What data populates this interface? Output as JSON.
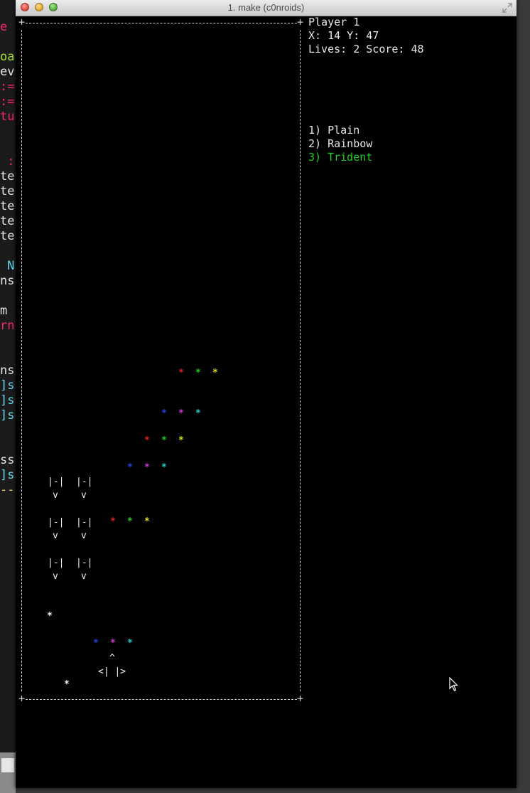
{
  "window": {
    "title": "1. make (c0nroids)"
  },
  "background_editor_fragments": [
    {
      "text": "e",
      "color": "#f92672"
    },
    {
      "text": "oa",
      "color": "#a6e22e"
    },
    {
      "text": "ev",
      "color": "#e6e6e6"
    },
    {
      "text": ":=",
      "color": "#f92672"
    },
    {
      "text": ":=",
      "color": "#f92672"
    },
    {
      "text": "tu",
      "color": "#f92672"
    },
    {
      "text": " :",
      "color": "#f92672"
    },
    {
      "text": "te",
      "color": "#e6e6e6"
    },
    {
      "text": "te",
      "color": "#e6e6e6"
    },
    {
      "text": "te",
      "color": "#e6e6e6"
    },
    {
      "text": "te",
      "color": "#e6e6e6"
    },
    {
      "text": "te",
      "color": "#e6e6e6"
    },
    {
      "text": " N",
      "color": "#66d9ef"
    },
    {
      "text": "ns",
      "color": "#e6e6e6"
    },
    {
      "text": "m",
      "color": "#e6e6e6"
    },
    {
      "text": "rn",
      "color": "#f92672"
    },
    {
      "text": "ns",
      "color": "#e6e6e6"
    },
    {
      "text": "]s",
      "color": "#66d9ef"
    },
    {
      "text": "]s",
      "color": "#66d9ef"
    },
    {
      "text": "]s",
      "color": "#66d9ef"
    },
    {
      "text": "ss",
      "color": "#e6e6e6"
    },
    {
      "text": "]s",
      "color": "#66d9ef"
    },
    {
      "text": "--",
      "color": "#e6db74"
    }
  ],
  "hud": {
    "player": "Player 1",
    "position": "X: 14 Y: 47",
    "lives_score": "Lives: 2 Score: 48"
  },
  "weapon_menu": {
    "items": [
      {
        "label": "1) Plain",
        "selected": false
      },
      {
        "label": "2) Rainbow",
        "selected": false
      },
      {
        "label": "3) Trident",
        "selected": true
      }
    ],
    "selected_color": "#22cc22",
    "default_color": "#e6e6e6"
  },
  "game": {
    "border_corner_char": "+",
    "invader_top": "|-|",
    "invader_bottom": "v",
    "player_ship_top": "^",
    "player_ship_bottom": "<| |>",
    "bullet_char": "*",
    "enemy_bullet_char": "*",
    "colors": {
      "red": "#dd2222",
      "green": "#22cc22",
      "yellow": "#dddd22",
      "blue": "#2244dd",
      "magenta": "#cc33cc",
      "cyan": "#22cccc",
      "white": "#f0f0f0"
    },
    "bullet_rows": [
      [
        "red",
        "green",
        "yellow"
      ],
      [
        "blue",
        "magenta",
        "cyan"
      ],
      [
        "red",
        "green",
        "yellow"
      ],
      [
        "blue",
        "magenta",
        "cyan"
      ],
      [
        "red",
        "green",
        "yellow"
      ],
      [
        "blue",
        "magenta",
        "cyan"
      ]
    ]
  }
}
